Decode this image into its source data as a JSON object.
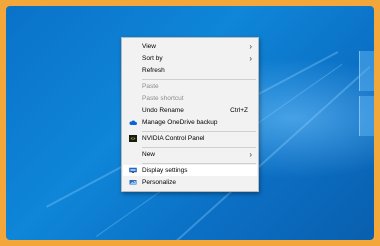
{
  "context_menu": {
    "items": [
      {
        "label": "View",
        "submenu": true,
        "disabled": false
      },
      {
        "label": "Sort by",
        "submenu": true,
        "disabled": false
      },
      {
        "label": "Refresh",
        "submenu": false,
        "disabled": false
      },
      {
        "label": "Paste",
        "submenu": false,
        "disabled": true
      },
      {
        "label": "Paste shortcut",
        "submenu": false,
        "disabled": true
      },
      {
        "label": "Undo Rename",
        "shortcut": "Ctrl+Z",
        "submenu": false,
        "disabled": false
      },
      {
        "label": "Manage OneDrive backup",
        "icon": "onedrive-cloud-icon",
        "submenu": false,
        "disabled": false
      },
      {
        "label": "NVIDIA Control Panel",
        "icon": "nvidia-icon",
        "submenu": false,
        "disabled": false
      },
      {
        "label": "New",
        "submenu": true,
        "disabled": false
      },
      {
        "label": "Display settings",
        "icon": "display-icon",
        "submenu": false,
        "disabled": false,
        "highlighted": true
      },
      {
        "label": "Personalize",
        "icon": "personalize-icon",
        "submenu": false,
        "disabled": false
      }
    ]
  },
  "colors": {
    "frame": "#f3a73a",
    "desktop": "#0f86d8",
    "menu_background": "#f2f2f2",
    "onedrive": "#0a64d6",
    "nvidia": "#76b900"
  }
}
